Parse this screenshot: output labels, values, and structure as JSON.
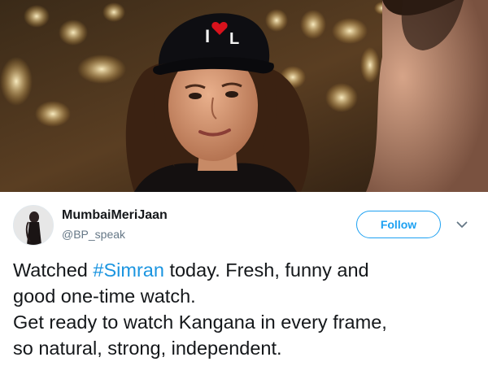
{
  "photo": {
    "cap_text": "I",
    "cap_text_2": "L"
  },
  "tweet": {
    "display_name": "MumbaiMeriJaan",
    "handle": "@BP_speak",
    "follow_label": "Follow",
    "caret_icon": "chevron-down-icon",
    "text": {
      "line1_before": "Watched ",
      "hashtag": "#Simran",
      "line1_after": " today. Fresh, funny and",
      "line2": "good one-time watch.",
      "line3": "Get ready to watch Kangana in every frame,",
      "line4": "so natural, strong, independent."
    }
  },
  "colors": {
    "accent": "#1da1f2",
    "hashtag": "#1b95e0",
    "text": "#14171a",
    "secondary": "#657786"
  }
}
